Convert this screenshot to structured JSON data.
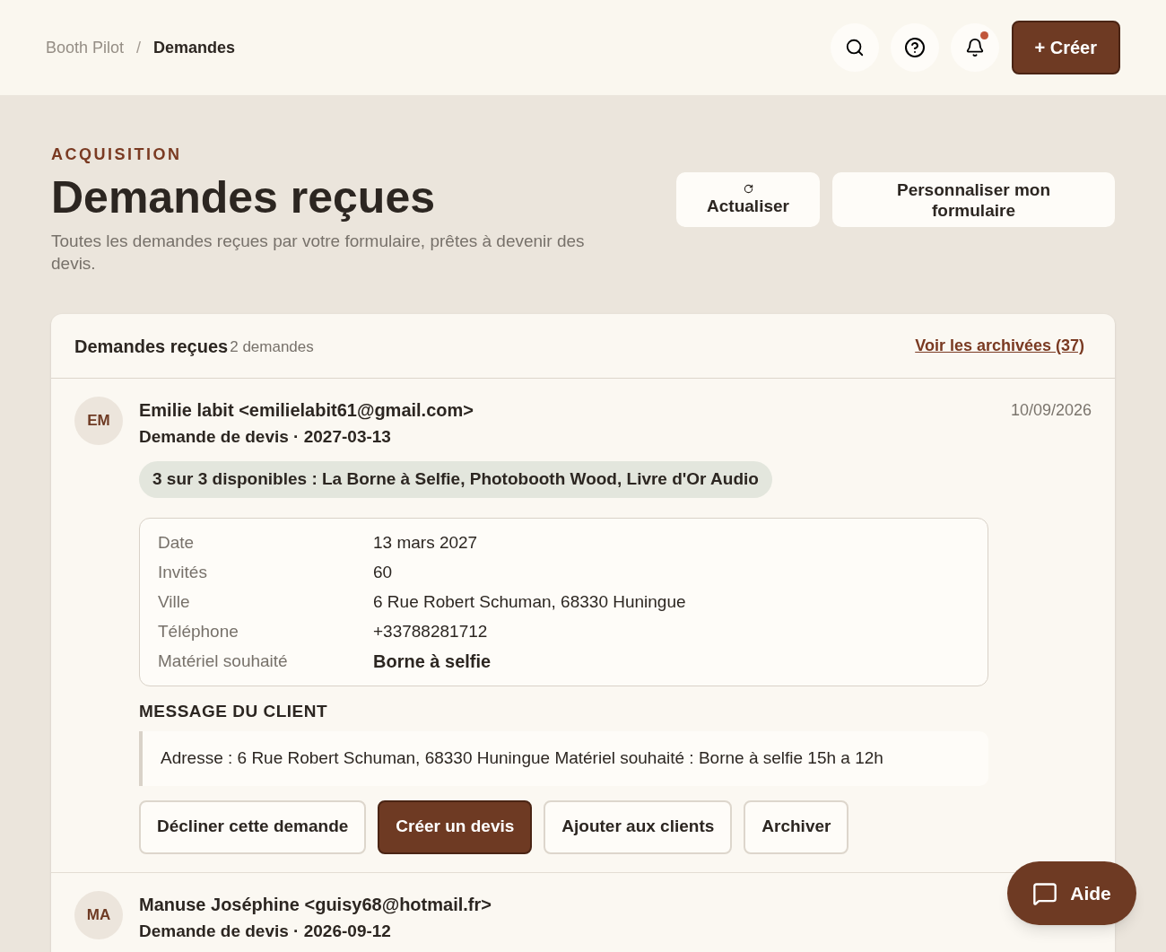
{
  "breadcrumb": [
    {
      "label": "Booth Pilot"
    },
    {
      "label": "Demandes"
    }
  ],
  "breadcrumb_separator": "/",
  "header": {
    "notification_dot": true,
    "create_button": "+ Créer"
  },
  "page": {
    "eyebrow": "ACQUISITION",
    "title": "Demandes reçues",
    "subtitle": "Toutes les demandes reçues par votre formulaire, prêtes à devenir des devis.",
    "actions": [
      {
        "label": "Actualiser",
        "kind": "refresh"
      },
      {
        "label": "Personnaliser mon formulaire",
        "kind": "plain"
      }
    ]
  },
  "panel": {
    "title": "Demandes reçues",
    "count": "2 demandes",
    "archive_link": "Voir les archivées (37)"
  },
  "requests": [
    {
      "initials": "EM",
      "name": "Emilie labit <emilielabit61@gmail.com>",
      "subtitle": "Demande de devis · 2027-03-13",
      "date": "10/09/2026",
      "availability": "3 sur 3 disponibles : La Borne à Selfie, Photobooth Wood, Livre d'Or Audio",
      "details": [
        {
          "label": "Date",
          "value": "13 mars 2027",
          "bold": false
        },
        {
          "label": "Invités",
          "value": "60",
          "bold": false
        },
        {
          "label": "Ville",
          "value": "6 Rue Robert Schuman, 68330 Huningue",
          "bold": false
        },
        {
          "label": "Téléphone",
          "value": "+33788281712",
          "bold": false
        },
        {
          "label": "Matériel souhaité",
          "value": "Borne à selfie",
          "bold": true
        }
      ],
      "message_heading": "MESSAGE DU CLIENT",
      "message": "Adresse : 6 Rue Robert Schuman, 68330 Huningue Matériel souhaité : Borne à selfie 15h a 12h",
      "buttons": [
        {
          "label": "Décliner cette demande",
          "primary": false
        },
        {
          "label": "Créer un devis",
          "primary": true
        },
        {
          "label": "Ajouter aux clients",
          "primary": false
        },
        {
          "label": "Archiver",
          "primary": false
        }
      ]
    },
    {
      "initials": "MA",
      "name": "Manuse Joséphine <guisy68@hotmail.fr>",
      "subtitle": "Demande de devis · 2026-09-12"
    }
  ],
  "help_button": "Aide"
}
